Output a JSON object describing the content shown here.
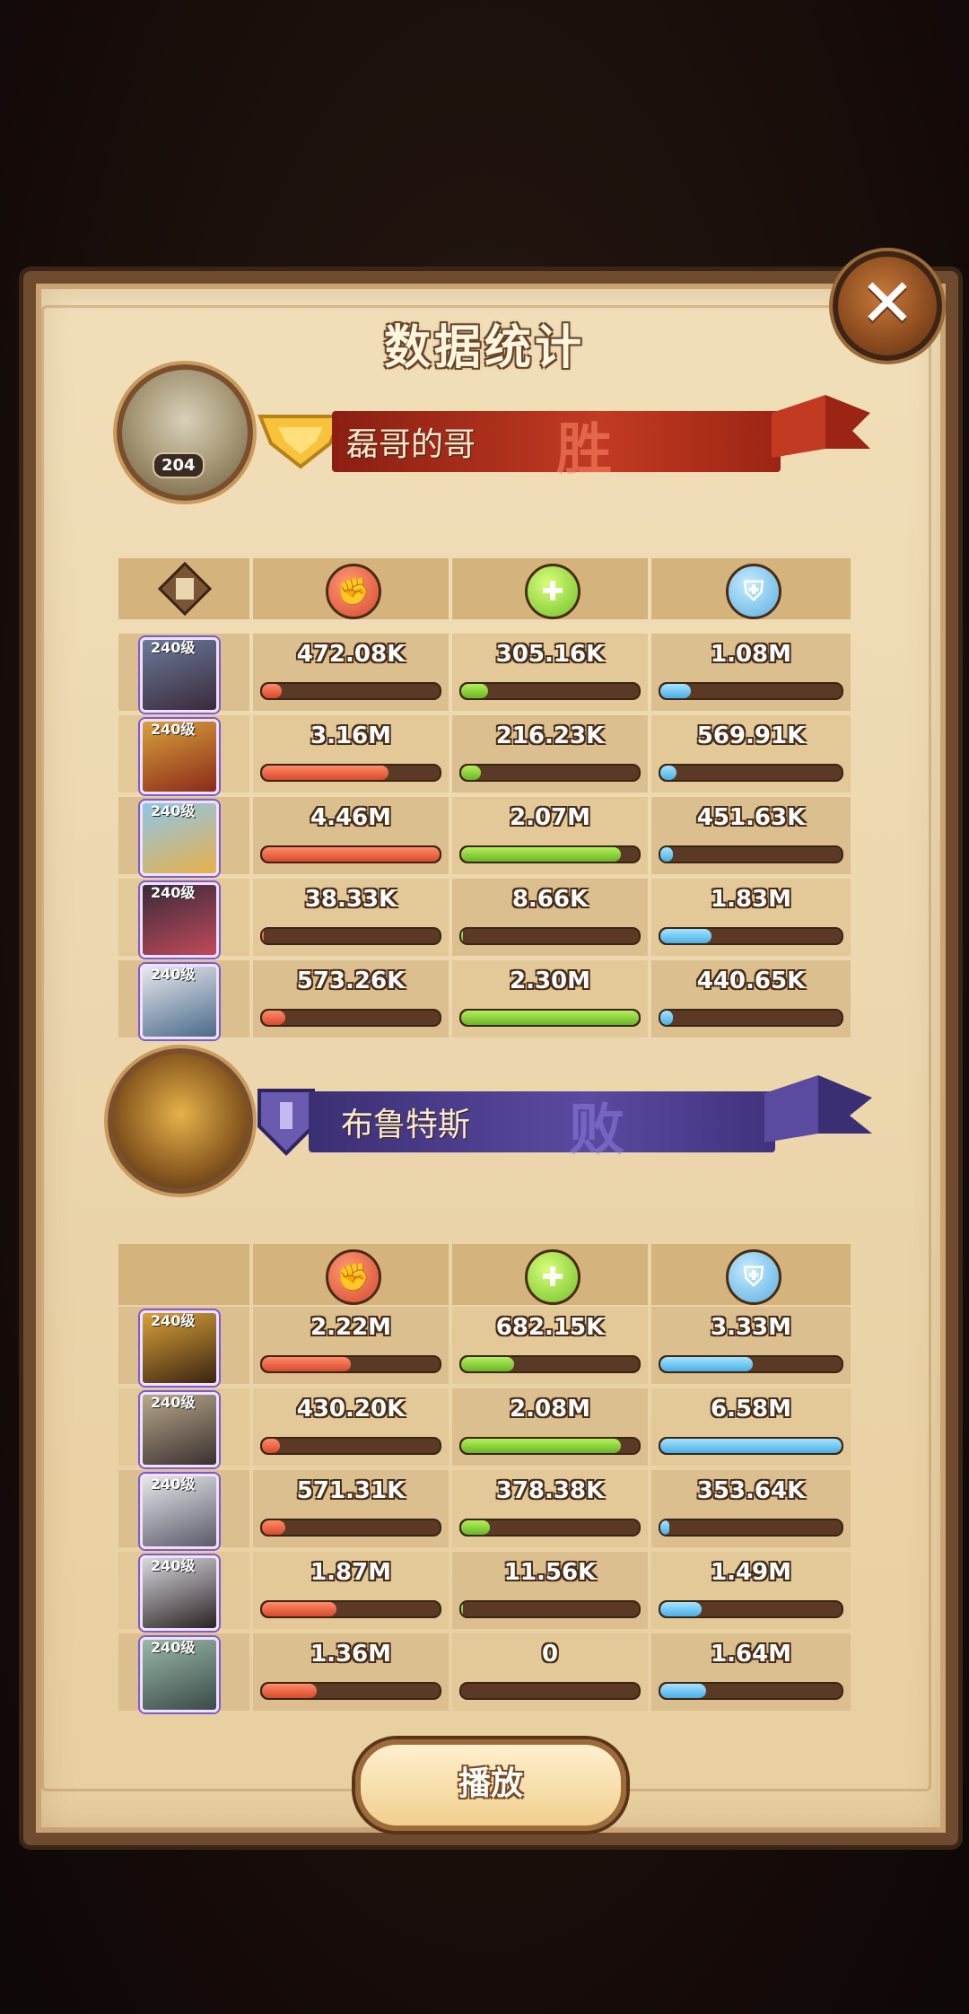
{
  "dialog": {
    "title": "数据统计",
    "close_icon": "close-icon",
    "play_label": "播放"
  },
  "teams": [
    {
      "name": "磊哥的哥",
      "result": "胜",
      "level": "204",
      "banner_color": "#b6301d",
      "heroes": [
        {
          "level": "240级",
          "damage": "472.08K",
          "healing": "305.16K",
          "tanked": "1.08M",
          "damage_frac": 0.11,
          "healing_frac": 0.15,
          "tanked_frac": 0.17
        },
        {
          "level": "240级",
          "damage": "3.16M",
          "healing": "216.23K",
          "tanked": "569.91K",
          "damage_frac": 0.71,
          "healing_frac": 0.11,
          "tanked_frac": 0.09
        },
        {
          "level": "240级",
          "damage": "4.46M",
          "healing": "2.07M",
          "tanked": "451.63K",
          "damage_frac": 1.0,
          "healing_frac": 0.9,
          "tanked_frac": 0.07
        },
        {
          "level": "240级",
          "damage": "38.33K",
          "healing": "8.66K",
          "tanked": "1.83M",
          "damage_frac": 0.01,
          "healing_frac": 0.01,
          "tanked_frac": 0.28
        },
        {
          "level": "240级",
          "damage": "573.26K",
          "healing": "2.30M",
          "tanked": "440.65K",
          "damage_frac": 0.13,
          "healing_frac": 1.0,
          "tanked_frac": 0.07
        }
      ]
    },
    {
      "name": "布鲁特斯",
      "result": "败",
      "banner_color": "#4a3c86",
      "heroes": [
        {
          "level": "240级",
          "damage": "2.22M",
          "healing": "682.15K",
          "tanked": "3.33M",
          "damage_frac": 0.5,
          "healing_frac": 0.3,
          "tanked_frac": 0.51
        },
        {
          "level": "240级",
          "damage": "430.20K",
          "healing": "2.08M",
          "tanked": "6.58M",
          "damage_frac": 0.1,
          "healing_frac": 0.9,
          "tanked_frac": 1.0
        },
        {
          "level": "240级",
          "damage": "571.31K",
          "healing": "378.38K",
          "tanked": "353.64K",
          "damage_frac": 0.13,
          "healing_frac": 0.16,
          "tanked_frac": 0.05
        },
        {
          "level": "240级",
          "damage": "1.87M",
          "healing": "11.56K",
          "tanked": "1.49M",
          "damage_frac": 0.42,
          "healing_frac": 0.01,
          "tanked_frac": 0.23
        },
        {
          "level": "240级",
          "damage": "1.36M",
          "healing": "0",
          "tanked": "1.64M",
          "damage_frac": 0.31,
          "healing_frac": 0.0,
          "tanked_frac": 0.25
        }
      ]
    }
  ],
  "columns": {
    "damage_icon": "fist-icon",
    "healing_icon": "heal-icon",
    "tanked_icon": "shield-icon",
    "hero_icon": "document-icon"
  }
}
